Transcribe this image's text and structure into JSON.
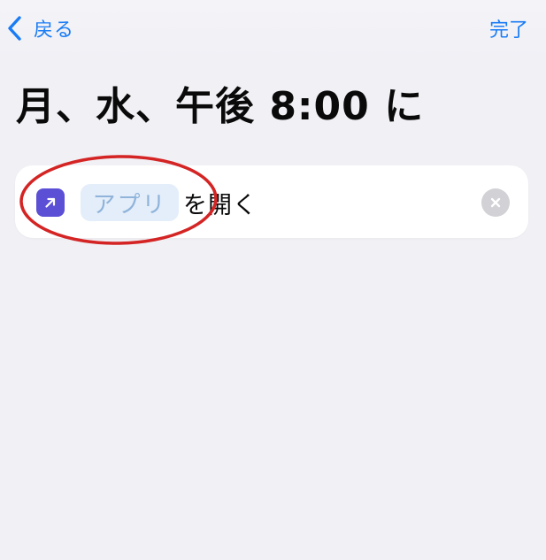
{
  "theme": {
    "accent": "#1a7cf5",
    "annotation": "#d42424",
    "app_icon": "#5b4fd6"
  },
  "nav": {
    "back_label": "戻る",
    "back_icon": "chevron-left-icon",
    "done_label": "完了"
  },
  "title": "月、水、午後 8:00 に",
  "action": {
    "app_icon": "arrow-up-right-icon",
    "app_placeholder": "アプリ",
    "suffix": "を開く",
    "clear_icon": "x-circle-icon"
  }
}
